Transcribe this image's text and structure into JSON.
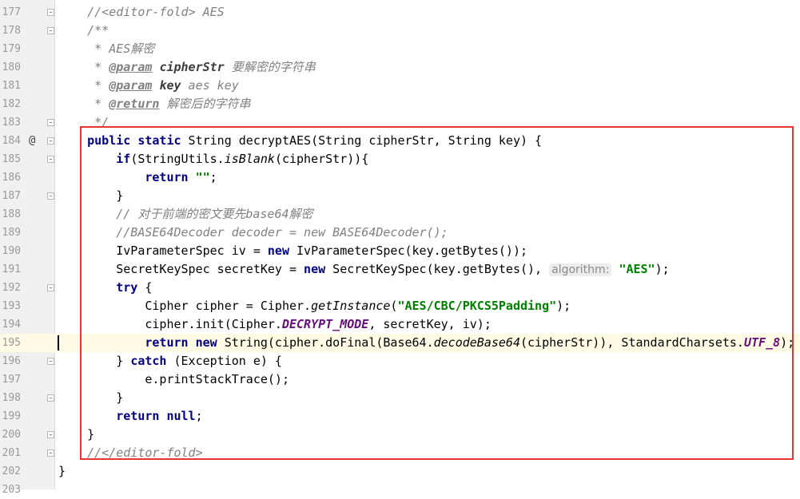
{
  "editor": {
    "current_line": 195,
    "highlight_color": "#e8342e",
    "lines": [
      {
        "n": "177",
        "tokens": [
          {
            "t": "    "
          },
          {
            "t": "//<editor-fold> AES",
            "c": "cm"
          }
        ]
      },
      {
        "n": "178",
        "tokens": [
          {
            "t": "    "
          },
          {
            "t": "/**",
            "c": "doc"
          }
        ]
      },
      {
        "n": "179",
        "tokens": [
          {
            "t": "     "
          },
          {
            "t": "* AES解密",
            "c": "doc"
          }
        ]
      },
      {
        "n": "180",
        "tokens": [
          {
            "t": "     "
          },
          {
            "t": "* ",
            "c": "doc"
          },
          {
            "t": "@param",
            "c": "tag"
          },
          {
            "t": " "
          },
          {
            "t": "cipherStr",
            "c": "pname"
          },
          {
            "t": " 要解密的字符串",
            "c": "doc"
          }
        ]
      },
      {
        "n": "181",
        "tokens": [
          {
            "t": "     "
          },
          {
            "t": "* ",
            "c": "doc"
          },
          {
            "t": "@param",
            "c": "tag"
          },
          {
            "t": " "
          },
          {
            "t": "key",
            "c": "pname"
          },
          {
            "t": " aes key",
            "c": "doc"
          }
        ]
      },
      {
        "n": "182",
        "tokens": [
          {
            "t": "     "
          },
          {
            "t": "* ",
            "c": "doc"
          },
          {
            "t": "@return",
            "c": "tag"
          },
          {
            "t": " 解密后的字符串",
            "c": "doc"
          }
        ]
      },
      {
        "n": "183",
        "tokens": [
          {
            "t": "     "
          },
          {
            "t": "*/",
            "c": "doc"
          }
        ]
      },
      {
        "n": "184",
        "mark": "@",
        "tokens": [
          {
            "t": "    "
          },
          {
            "t": "public static",
            "c": "kw"
          },
          {
            "t": " String decryptAES(String cipherStr, String key) {"
          }
        ]
      },
      {
        "n": "185",
        "tokens": [
          {
            "t": "        "
          },
          {
            "t": "if",
            "c": "kw"
          },
          {
            "t": "(StringUtils."
          },
          {
            "t": "isBlank",
            "c": "ital"
          },
          {
            "t": "(cipherStr)){"
          }
        ]
      },
      {
        "n": "186",
        "tokens": [
          {
            "t": "            "
          },
          {
            "t": "return",
            "c": "kw"
          },
          {
            "t": " "
          },
          {
            "t": "\"\"",
            "c": "str"
          },
          {
            "t": ";"
          }
        ]
      },
      {
        "n": "187",
        "tokens": [
          {
            "t": "        }"
          }
        ]
      },
      {
        "n": "188",
        "tokens": [
          {
            "t": "        "
          },
          {
            "t": "// 对于前端的密文要先base64解密",
            "c": "cm"
          }
        ]
      },
      {
        "n": "189",
        "tokens": [
          {
            "t": "        "
          },
          {
            "t": "//BASE64Decoder decoder = new BASE64Decoder();",
            "c": "cm"
          }
        ]
      },
      {
        "n": "190",
        "tokens": [
          {
            "t": "        IvParameterSpec iv = "
          },
          {
            "t": "new",
            "c": "kw"
          },
          {
            "t": " IvParameterSpec(key.getBytes());"
          }
        ]
      },
      {
        "n": "191",
        "tokens": [
          {
            "t": "        SecretKeySpec secretKey = "
          },
          {
            "t": "new",
            "c": "kw"
          },
          {
            "t": " SecretKeySpec(key.getBytes(), "
          },
          {
            "t": "algorithm:",
            "c": "hint"
          },
          {
            "t": " "
          },
          {
            "t": "\"AES\"",
            "c": "str"
          },
          {
            "t": ");"
          }
        ]
      },
      {
        "n": "192",
        "tokens": [
          {
            "t": "        "
          },
          {
            "t": "try",
            "c": "kw"
          },
          {
            "t": " {"
          }
        ]
      },
      {
        "n": "193",
        "tokens": [
          {
            "t": "            Cipher cipher = Cipher."
          },
          {
            "t": "getInstance",
            "c": "ital"
          },
          {
            "t": "("
          },
          {
            "t": "\"AES/CBC/PKCS5Padding\"",
            "c": "str"
          },
          {
            "t": ");"
          }
        ]
      },
      {
        "n": "194",
        "tokens": [
          {
            "t": "            cipher.init(Cipher."
          },
          {
            "t": "DECRYPT_MODE",
            "c": "const"
          },
          {
            "t": ", secretKey, iv);"
          }
        ]
      },
      {
        "n": "195",
        "tokens": [
          {
            "t": "            "
          },
          {
            "t": "return new",
            "c": "kw"
          },
          {
            "t": " String(cipher.doFinal(Base64."
          },
          {
            "t": "decodeBase64",
            "c": "ital"
          },
          {
            "t": "(cipherStr)), StandardCharsets."
          },
          {
            "t": "UTF_8",
            "c": "const"
          },
          {
            "t": ");"
          }
        ]
      },
      {
        "n": "196",
        "tokens": [
          {
            "t": "        } "
          },
          {
            "t": "catch",
            "c": "kw"
          },
          {
            "t": " (Exception e) {"
          }
        ]
      },
      {
        "n": "197",
        "tokens": [
          {
            "t": "            e.printStackTrace();"
          }
        ]
      },
      {
        "n": "198",
        "tokens": [
          {
            "t": "        }"
          }
        ]
      },
      {
        "n": "199",
        "tokens": [
          {
            "t": "        "
          },
          {
            "t": "return null",
            "c": "kw"
          },
          {
            "t": ";"
          }
        ]
      },
      {
        "n": "200",
        "tokens": [
          {
            "t": "    }"
          }
        ]
      },
      {
        "n": "201",
        "tokens": [
          {
            "t": "    "
          },
          {
            "t": "//</editor-fold>",
            "c": "cm"
          }
        ]
      },
      {
        "n": "202",
        "tokens": [
          {
            "t": "}"
          }
        ]
      },
      {
        "n": "203",
        "tokens": []
      }
    ]
  }
}
